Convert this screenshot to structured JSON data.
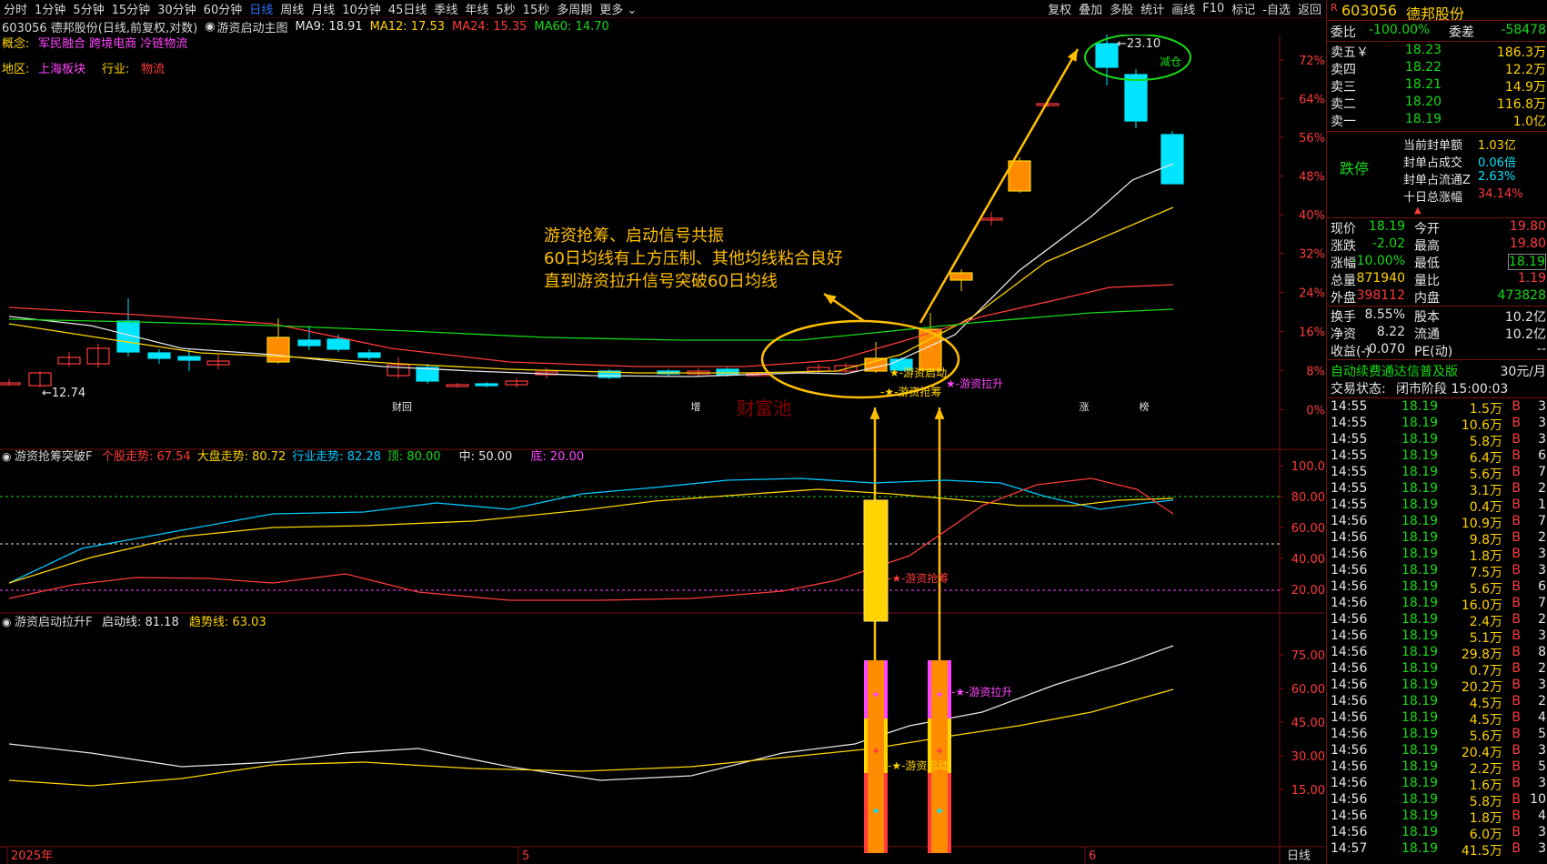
{
  "toolbar": {
    "timeframes": [
      "分时",
      "1分钟",
      "5分钟",
      "15分钟",
      "30分钟",
      "60分钟",
      "日线",
      "周线",
      "月线",
      "10分钟",
      "45日线",
      "季线",
      "年线",
      "5秒",
      "15秒",
      "多周期",
      "更多"
    ],
    "active_index": 6,
    "right_buttons": [
      "复权",
      "叠加",
      "多股",
      "统计",
      "画线",
      "F10",
      "标记",
      "-自选",
      "返回"
    ]
  },
  "title": {
    "stock": "603056 德邦股份(日线,前复权,对数)",
    "indicator": "游资启动主图",
    "ma9": "MA9: 18.91",
    "ma12": "MA12: 17.53",
    "ma24": "MA24: 15.35",
    "ma60": "MA60: 14.70"
  },
  "info": {
    "concept_label": "概念:",
    "concepts": "军民融合 跨境电商 冷链物流",
    "region_label": "地区:",
    "region": "上海板块",
    "industry_label": "行业:",
    "industry": "物流"
  },
  "annotations": {
    "main_text": [
      "游资抢筹、启动信号共振",
      "60日均线有上方压制、其他均线粘合良好",
      "直到游资拉升信号突破60日均线"
    ],
    "low_price": "←12.74",
    "high_price": "←23.10",
    "high_tag": "减仓",
    "sig_start": "★-游资启动",
    "sig_grab": "-★-游资抢筹",
    "sig_raise": "★-游资拉升",
    "sub1_grab": "-★-游资抢筹",
    "sub2_raise": "-★-游资拉升",
    "sub2_start": "-★-游资启动",
    "watermark": "财富池",
    "markers": [
      "财回",
      "增",
      "涨",
      "榜"
    ]
  },
  "price_axis": [
    "72%",
    "64%",
    "56%",
    "48%",
    "40%",
    "32%",
    "24%",
    "16%",
    "8%",
    "0%"
  ],
  "sub1": {
    "name": "游资抢筹突破F",
    "items": [
      {
        "t": "个股走势: 67.54",
        "c": "#ff3b3b"
      },
      {
        "t": "大盘走势: 80.72",
        "c": "#ffd400"
      },
      {
        "t": "行业走势: 82.28",
        "c": "#00c8ff"
      },
      {
        "t": "顶: 80.00",
        "c": "#16d916"
      },
      {
        "t": "中: 50.00",
        "c": "#e6e6e6"
      },
      {
        "t": "底: 20.00",
        "c": "#ff44ff"
      }
    ],
    "axis": [
      "100.0",
      "80.00",
      "60.00",
      "40.00",
      "20.00"
    ]
  },
  "sub2": {
    "name": "游资启动拉升F",
    "items": [
      {
        "t": "启动线: 81.18",
        "c": "#e6e6e6"
      },
      {
        "t": "趋势线: 63.03",
        "c": "#ffd400"
      }
    ],
    "axis": [
      "75.00",
      "60.00",
      "45.00",
      "30.00",
      "15.00"
    ]
  },
  "date_axis": {
    "labels": [
      "2025年",
      "5",
      "6"
    ],
    "period": "日线"
  },
  "panel": {
    "code": "603056",
    "name": "德邦股份",
    "weibi_label": "委比",
    "weibi": "-100.00%",
    "weicha_label": "委差",
    "weicha": "-58478",
    "sells": [
      {
        "label": "卖五￥",
        "price": "18.23",
        "vol": "186.3万"
      },
      {
        "label": "卖四",
        "price": "18.22",
        "vol": "12.2万"
      },
      {
        "label": "卖三",
        "price": "18.21",
        "vol": "14.9万"
      },
      {
        "label": "卖二",
        "price": "18.20",
        "vol": "116.8万"
      },
      {
        "label": "卖一",
        "price": "18.19",
        "vol": "1.0亿"
      }
    ],
    "limit_label": "跌停",
    "seal": [
      {
        "label": "当前封单额",
        "value": "1.03亿"
      },
      {
        "label": "封单占成交",
        "value": "0.06倍"
      },
      {
        "label": "封单占流通Z",
        "value": "2.63%"
      },
      {
        "label": "十日总涨幅",
        "value": "34.14%"
      }
    ],
    "quote": [
      {
        "l1": "现价",
        "v1": "18.19",
        "c1": "grn",
        "l2": "今开",
        "v2": "19.80",
        "c2": "red"
      },
      {
        "l1": "涨跌",
        "v1": "-2.02",
        "c1": "grn",
        "l2": "最高",
        "v2": "19.80",
        "c2": "red"
      },
      {
        "l1": "涨幅",
        "v1": "-10.00%",
        "c1": "grn",
        "l2": "最低",
        "v2": "18.19",
        "c2": "grn"
      },
      {
        "l1": "总量",
        "v1": "871940",
        "c1": "yel",
        "l2": "量比",
        "v2": "1.19",
        "c2": "red"
      },
      {
        "l1": "外盘",
        "v1": "398112",
        "c1": "red",
        "l2": "内盘",
        "v2": "473828",
        "c2": "grn"
      }
    ],
    "stats": [
      {
        "l1": "换手",
        "v1": "8.55%",
        "l2": "股本",
        "v2": "10.2亿"
      },
      {
        "l1": "净资",
        "v1": "8.22",
        "l2": "流通",
        "v2": "10.2亿"
      },
      {
        "l1": "收益(-)",
        "v1": "-0.070",
        "l2": "PE(动)",
        "v2": "--"
      }
    ],
    "ad_text": "自动续费通达信普及版",
    "ad_price": "30元/月",
    "status_label": "交易状态:",
    "status": "闭市阶段 15:00:03",
    "ticks": [
      [
        "14:55",
        "18.19",
        "1.5万",
        "B",
        "3"
      ],
      [
        "14:55",
        "18.19",
        "10.6万",
        "B",
        "3"
      ],
      [
        "14:55",
        "18.19",
        "5.8万",
        "B",
        "3"
      ],
      [
        "14:55",
        "18.19",
        "6.4万",
        "B",
        "6"
      ],
      [
        "14:55",
        "18.19",
        "5.6万",
        "B",
        "7"
      ],
      [
        "14:55",
        "18.19",
        "3.1万",
        "B",
        "2"
      ],
      [
        "14:55",
        "18.19",
        "0.4万",
        "B",
        "1"
      ],
      [
        "14:56",
        "18.19",
        "10.9万",
        "B",
        "7"
      ],
      [
        "14:56",
        "18.19",
        "9.8万",
        "B",
        "2"
      ],
      [
        "14:56",
        "18.19",
        "1.8万",
        "B",
        "3"
      ],
      [
        "14:56",
        "18.19",
        "7.5万",
        "B",
        "3"
      ],
      [
        "14:56",
        "18.19",
        "5.6万",
        "B",
        "6"
      ],
      [
        "14:56",
        "18.19",
        "16.0万",
        "B",
        "7"
      ],
      [
        "14:56",
        "18.19",
        "2.4万",
        "B",
        "2"
      ],
      [
        "14:56",
        "18.19",
        "5.1万",
        "B",
        "3"
      ],
      [
        "14:56",
        "18.19",
        "29.8万",
        "B",
        "8"
      ],
      [
        "14:56",
        "18.19",
        "0.7万",
        "B",
        "2"
      ],
      [
        "14:56",
        "18.19",
        "20.2万",
        "B",
        "3"
      ],
      [
        "14:56",
        "18.19",
        "4.5万",
        "B",
        "2"
      ],
      [
        "14:56",
        "18.19",
        "4.5万",
        "B",
        "4"
      ],
      [
        "14:56",
        "18.19",
        "5.6万",
        "B",
        "5"
      ],
      [
        "14:56",
        "18.19",
        "20.4万",
        "B",
        "3"
      ],
      [
        "14:56",
        "18.19",
        "2.2万",
        "B",
        "5"
      ],
      [
        "14:56",
        "18.19",
        "1.6万",
        "B",
        "3"
      ],
      [
        "14:56",
        "18.19",
        "5.8万",
        "B",
        "10"
      ],
      [
        "14:56",
        "18.19",
        "1.8万",
        "B",
        "4"
      ],
      [
        "14:56",
        "18.19",
        "6.0万",
        "B",
        "3"
      ],
      [
        "14:57",
        "18.19",
        "41.5万",
        "B",
        "3"
      ]
    ]
  }
}
